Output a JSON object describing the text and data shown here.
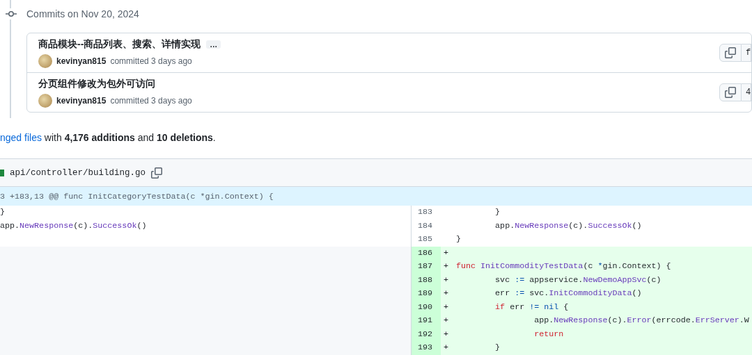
{
  "commit_group": {
    "heading": "Commits on Nov 20, 2024",
    "commits": [
      {
        "title": "商品模块--商品列表、搜索、详情实现",
        "more_label": "…",
        "author": "kevinyan815",
        "meta": "committed 3 days ago",
        "sha": "f"
      },
      {
        "title": "分页组件修改为包外可访问",
        "author": "kevinyan815",
        "meta": "committed 3 days ago",
        "sha": "4"
      }
    ]
  },
  "summary": {
    "link": "nged files",
    "text": "with **4,176 additions** and **10 deletions**."
  },
  "diff_file": {
    "path": "api/controller/building.go",
    "hunk": "3 +183,13 @@ func InitCategoryTestData(c *gin.Context) {",
    "rows": [
      {
        "left": [
          {
            "kind": "plain",
            "text": "}"
          }
        ],
        "right": {
          "number": "183",
          "added": false,
          "tokens": [
            {
              "kind": "plain",
              "text": "\t}"
            }
          ]
        }
      },
      {
        "left": [
          {
            "kind": "plain",
            "text": "app."
          },
          {
            "kind": "func",
            "text": "NewResponse"
          },
          {
            "kind": "plain",
            "text": "(c)."
          },
          {
            "kind": "func",
            "text": "SuccessOk"
          },
          {
            "kind": "plain",
            "text": "()"
          }
        ],
        "right": {
          "number": "184",
          "added": false,
          "tokens": [
            {
              "kind": "plain",
              "text": "\tapp."
            },
            {
              "kind": "func",
              "text": "NewResponse"
            },
            {
              "kind": "plain",
              "text": "(c)."
            },
            {
              "kind": "func",
              "text": "SuccessOk"
            },
            {
              "kind": "plain",
              "text": "()"
            }
          ]
        }
      },
      {
        "left": [],
        "right": {
          "number": "185",
          "added": false,
          "tokens": [
            {
              "kind": "plain",
              "text": "}"
            }
          ]
        }
      },
      {
        "right": {
          "number": "186",
          "added": true,
          "sign": "+"
        }
      },
      {
        "right": {
          "number": "187",
          "added": true,
          "sign": "+",
          "tokens": [
            {
              "kind": "keyword",
              "text": "func"
            },
            {
              "kind": "func",
              "text": " InitCommodityTestData"
            },
            {
              "kind": "plain",
              "text": "(c "
            },
            {
              "kind": "op",
              "text": "*"
            },
            {
              "kind": "plain",
              "text": "gin.Context) {"
            }
          ]
        }
      },
      {
        "right": {
          "number": "188",
          "added": true,
          "sign": "+",
          "tokens": [
            {
              "kind": "plain",
              "text": "\tsvc "
            },
            {
              "kind": "op",
              "text": ":="
            },
            {
              "kind": "plain",
              "text": " appservice."
            },
            {
              "kind": "func",
              "text": "NewDemoAppSvc"
            },
            {
              "kind": "plain",
              "text": "(c)"
            }
          ]
        }
      },
      {
        "right": {
          "number": "189",
          "added": true,
          "sign": "+",
          "tokens": [
            {
              "kind": "plain",
              "text": "\terr "
            },
            {
              "kind": "op",
              "text": ":="
            },
            {
              "kind": "plain",
              "text": " svc."
            },
            {
              "kind": "func",
              "text": "InitCommodityData"
            },
            {
              "kind": "plain",
              "text": "()"
            }
          ]
        }
      },
      {
        "right": {
          "number": "190",
          "added": true,
          "sign": "+",
          "tokens": [
            {
              "kind": "keyword",
              "text": "\tif"
            },
            {
              "kind": "plain",
              "text": " err "
            },
            {
              "kind": "op",
              "text": "!="
            },
            {
              "kind": "op",
              "text": " nil"
            },
            {
              "kind": "plain",
              "text": " {"
            }
          ]
        }
      },
      {
        "right": {
          "number": "191",
          "added": true,
          "sign": "+",
          "tokens": [
            {
              "kind": "plain",
              "text": "\t\tapp."
            },
            {
              "kind": "func",
              "text": "NewResponse"
            },
            {
              "kind": "plain",
              "text": "(c)."
            },
            {
              "kind": "func",
              "text": "Error"
            },
            {
              "kind": "plain",
              "text": "(errcode."
            },
            {
              "kind": "func",
              "text": "ErrServer"
            },
            {
              "kind": "plain",
              "text": ".W"
            }
          ]
        }
      },
      {
        "right": {
          "number": "192",
          "added": true,
          "sign": "+",
          "tokens": [
            {
              "kind": "keyword",
              "text": "\t\treturn"
            }
          ]
        }
      },
      {
        "right": {
          "number": "193",
          "added": true,
          "sign": "+",
          "tokens": [
            {
              "kind": "plain",
              "text": "\t}"
            }
          ]
        }
      }
    ]
  }
}
